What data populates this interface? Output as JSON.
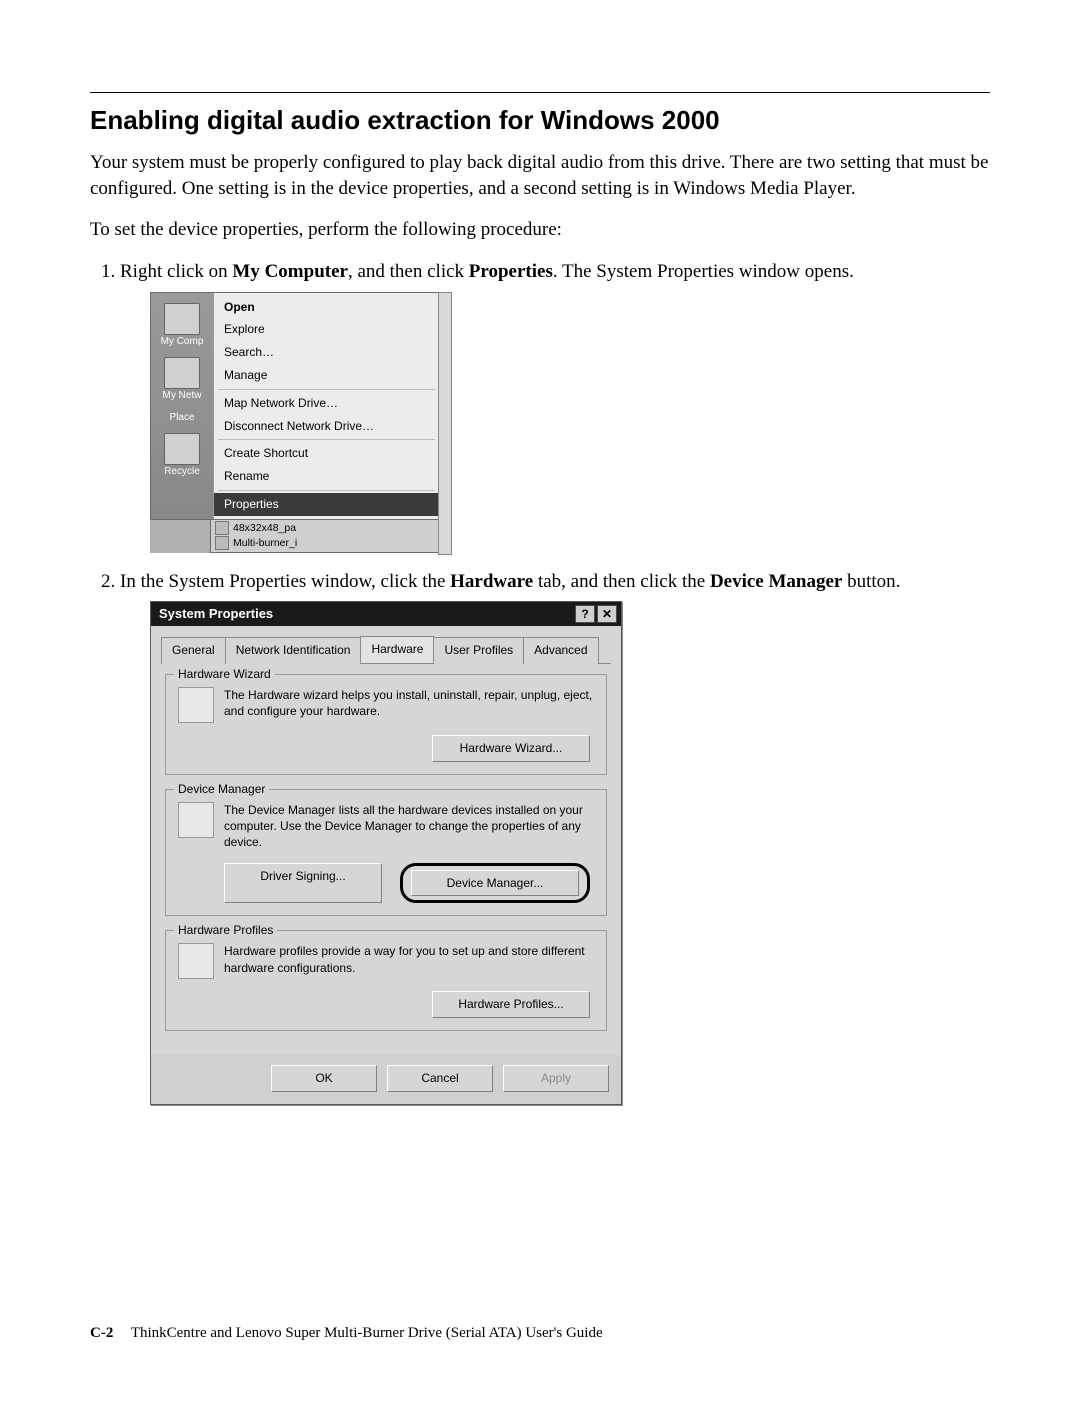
{
  "title": "Enabling digital audio extraction for Windows 2000",
  "intro": "Your system must be properly configured to play back digital audio from this drive. There are two setting that must be configured. One setting is in the device properties, and a second setting is in Windows Media Player.",
  "lead": "To set the device properties, perform the following procedure:",
  "step1_pre": "Right click on ",
  "step1_b1": "My Computer",
  "step1_mid": ", and then click ",
  "step1_b2": "Properties",
  "step1_post": ". The System Properties window opens.",
  "step2_pre": "In the System Properties window, click the ",
  "step2_b1": "Hardware",
  "step2_mid": " tab, and then click the ",
  "step2_b2": "Device Manager",
  "step2_post": " button.",
  "fig1": {
    "desk": {
      "mycomp": "My Comp",
      "mynet": "My Netw",
      "places": "Place",
      "recycle": "Recycle"
    },
    "menu": {
      "open": "Open",
      "explore": "Explore",
      "search": "Search…",
      "manage": "Manage",
      "map": "Map Network Drive…",
      "disc": "Disconnect Network Drive…",
      "shortcut": "Create Shortcut",
      "rename": "Rename",
      "properties": "Properties"
    },
    "tray": {
      "a": "48x32x48_pa",
      "b": "Multi-burner_i"
    }
  },
  "fig2": {
    "title": "System Properties",
    "tabs": {
      "general": "General",
      "netid": "Network Identification",
      "hardware": "Hardware",
      "userprof": "User Profiles",
      "advanced": "Advanced"
    },
    "g1": {
      "legend": "Hardware Wizard",
      "text": "The Hardware wizard helps you install, uninstall, repair, unplug, eject, and configure your hardware.",
      "btn": "Hardware Wizard..."
    },
    "g2": {
      "legend": "Device Manager",
      "text": "The Device Manager lists all the hardware devices installed on your computer. Use the Device Manager to change the properties of any device.",
      "btn_sign": "Driver Signing...",
      "btn_dm": "Device Manager..."
    },
    "g3": {
      "legend": "Hardware Profiles",
      "text": "Hardware profiles provide a way for you to set up and store different hardware configurations.",
      "btn": "Hardware Profiles..."
    },
    "footer": {
      "ok": "OK",
      "cancel": "Cancel",
      "apply": "Apply"
    }
  },
  "footer": {
    "page": "C-2",
    "guide": "ThinkCentre and Lenovo Super Multi-Burner Drive (Serial ATA) User's Guide"
  }
}
